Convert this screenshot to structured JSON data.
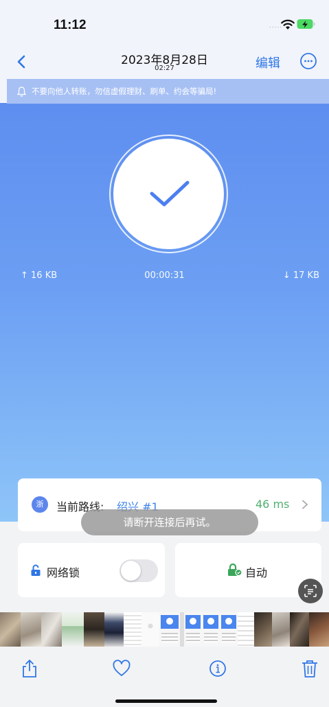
{
  "status_bar": {
    "time": "11:12",
    "signal_dots": "....."
  },
  "nav": {
    "date": "2023年8月28日",
    "time": "02:27",
    "edit_label": "编辑"
  },
  "notice": {
    "text": "不要向他人转账，勿信虚假理财、刷单、约会等骗局!"
  },
  "connection": {
    "status": "connected",
    "upload": "↑ 16 KB",
    "duration": "00:00:31",
    "download": "↓ 17 KB"
  },
  "route": {
    "badge": "浙",
    "label": "当前路线:",
    "value": "绍兴 #1",
    "latency": "46 ms"
  },
  "toast": {
    "text": "请断开连接后再试。"
  },
  "lock_card": {
    "label": "网络锁",
    "toggle_on": false
  },
  "auto_card": {
    "label": "自动"
  },
  "colors": {
    "accent": "#2f76e6",
    "gradient_top": "#5e8ef0",
    "gradient_bottom": "#8ec5f8",
    "latency": "#4fb06f",
    "lock_icon": "#2f76e6",
    "auto_icon": "#3aa65a"
  },
  "toolbar": {
    "icons": [
      "share-icon",
      "heart-icon",
      "info-icon",
      "trash-icon"
    ]
  }
}
